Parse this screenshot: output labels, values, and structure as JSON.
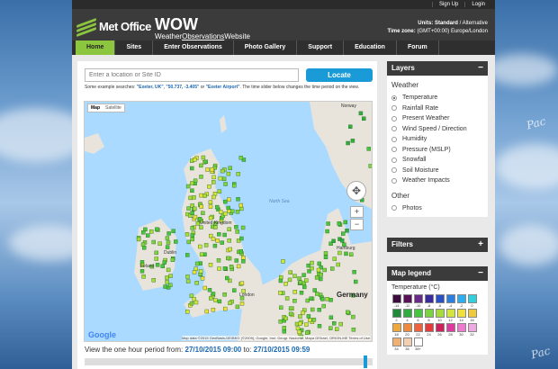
{
  "topbar": {
    "signup": "Sign Up",
    "login": "Login"
  },
  "brand": {
    "metoffice": "Met Office",
    "wow": "WOW",
    "wow_sub_part1": "Weather",
    "wow_sub_part2": "Observations",
    "wow_sub_part3": "Website"
  },
  "units": {
    "label": "Units:",
    "value": "Standard",
    "sep": " / ",
    "alt": "Alternative",
    "tz_label": "Time zone:",
    "tz_value": "(GMT+00:00) Europe/London"
  },
  "nav": [
    {
      "label": "Home",
      "active": true
    },
    {
      "label": "Sites"
    },
    {
      "label": "Enter Observations"
    },
    {
      "label": "Photo Gallery"
    },
    {
      "label": "Support"
    },
    {
      "label": "Education"
    },
    {
      "label": "Forum"
    }
  ],
  "search": {
    "placeholder": "Enter a location or Site ID",
    "button": "Locate"
  },
  "hint": {
    "prefix": "Some example searches: ",
    "ex1": "\"Exeter, UK\"",
    "ex2": "\"50.737, -3.405\"",
    "ex3": "\"Exeter Airport\"",
    "mid1": ", ",
    "mid2": " or ",
    "suffix": ". The time slider below changes the time period on the view."
  },
  "map": {
    "toggle_map": "Map",
    "toggle_sat": "Satellite",
    "labels": {
      "norway": "Norway",
      "north_sea": "North Sea",
      "uk": "United Kingdom",
      "dublin": "Dublin",
      "ireland": "Ireland",
      "hamburg": "Hamburg",
      "germany": "Germany",
      "london": "London"
    },
    "attribution": "Map data ©2015 GeoBasis-DE/BKG (©2009), Google, Inst. Geogr. Nacional, Mapa GISrael, ORION-ME   Terms of Use",
    "google": "Google"
  },
  "period": {
    "prefix": "View the one hour period",
    "from_label": "from:",
    "from": "27/10/2015 09:00",
    "to_label": "to:",
    "to": "27/10/2015 09:59"
  },
  "slider": {
    "position_fraction": 0.98
  },
  "layers": {
    "title": "Layers",
    "collapse": "−",
    "weather_title": "Weather",
    "weather": [
      {
        "label": "Temperature",
        "selected": true
      },
      {
        "label": "Rainfall Rate"
      },
      {
        "label": "Present Weather"
      },
      {
        "label": "Wind Speed / Direction"
      },
      {
        "label": "Humidity"
      },
      {
        "label": "Pressure (MSLP)"
      },
      {
        "label": "Snowfall"
      },
      {
        "label": "Soil Moisture"
      },
      {
        "label": "Weather Impacts"
      }
    ],
    "other_title": "Other",
    "other": [
      {
        "label": "Photos"
      }
    ]
  },
  "filters": {
    "title": "Filters",
    "expand": "+"
  },
  "legend": {
    "title": "Map legend",
    "collapse": "−",
    "subtitle": "Temperature (°C)",
    "items": [
      {
        "label": "-14",
        "color": "#3d0a3d"
      },
      {
        "label": "-12",
        "color": "#5a0f5a"
      },
      {
        "label": "-10",
        "color": "#6a2a8a"
      },
      {
        "label": "-8",
        "color": "#3a2aa0"
      },
      {
        "label": "-6",
        "color": "#2a50c8"
      },
      {
        "label": "-4",
        "color": "#2a7fe0"
      },
      {
        "label": "-2",
        "color": "#2ab0f0"
      },
      {
        "label": "0",
        "color": "#30d0e0"
      },
      {
        "label": "2",
        "color": "#1e8a3a"
      },
      {
        "label": "4",
        "color": "#2fae3f"
      },
      {
        "label": "6",
        "color": "#46c63f"
      },
      {
        "label": "8",
        "color": "#7ad43f"
      },
      {
        "label": "10",
        "color": "#a6dc3a"
      },
      {
        "label": "12",
        "color": "#d4e63a"
      },
      {
        "label": "14",
        "color": "#f0e03a"
      },
      {
        "label": "16",
        "color": "#f0c83a"
      },
      {
        "label": "18",
        "color": "#f0a83a"
      },
      {
        "label": "20",
        "color": "#f08a3a"
      },
      {
        "label": "22",
        "color": "#f0603a"
      },
      {
        "label": "24",
        "color": "#e83a3a"
      },
      {
        "label": "26",
        "color": "#d01f5a"
      },
      {
        "label": "28",
        "color": "#e03aa0"
      },
      {
        "label": "30",
        "color": "#f07ad0"
      },
      {
        "label": "32",
        "color": "#f0a8e0"
      },
      {
        "label": "34",
        "color": "#f0b070"
      },
      {
        "label": "36",
        "color": "#f0d0b0"
      },
      {
        "label": "38+",
        "color": "#ffffff"
      }
    ]
  },
  "watermark": {
    "top": "Pac",
    "bottom": "Pac"
  }
}
